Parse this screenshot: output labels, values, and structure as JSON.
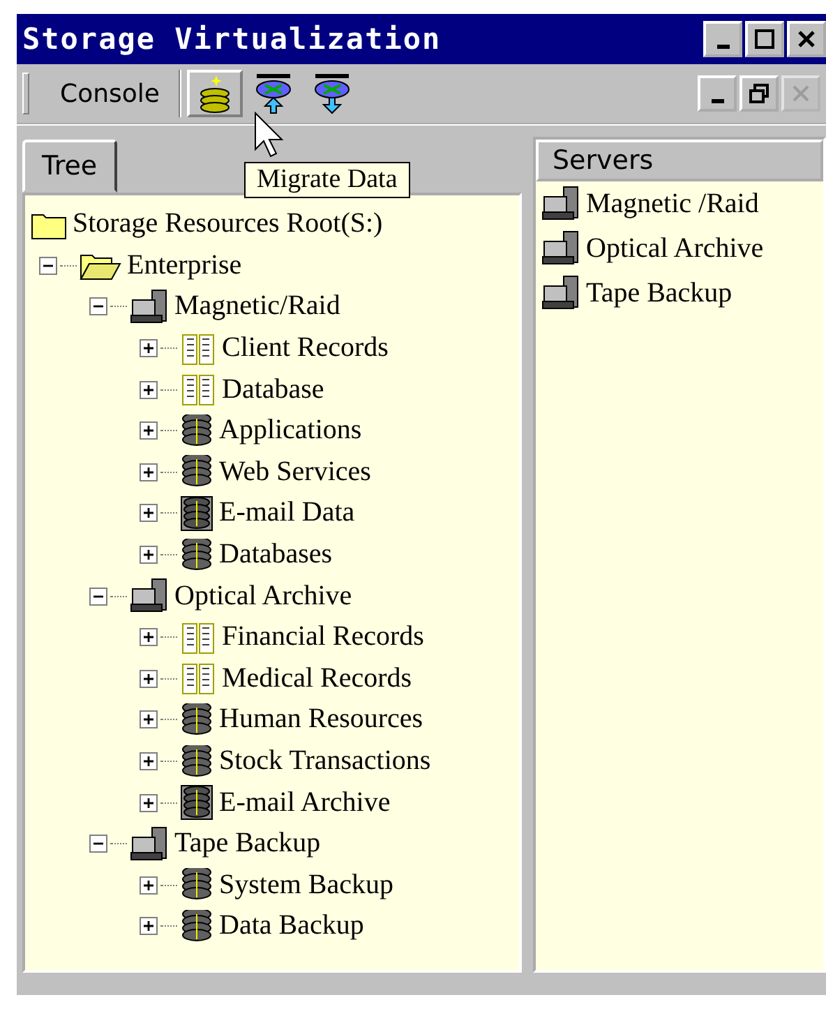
{
  "window": {
    "title": "Storage Virtualization"
  },
  "toolbar": {
    "menu": "Console",
    "buttons": [
      {
        "kind": "migrate",
        "pressed": true
      },
      {
        "kind": "upload",
        "pressed": false
      },
      {
        "kind": "download",
        "pressed": false
      }
    ],
    "tooltip": "Migrate Data"
  },
  "tabs": [
    {
      "label": "Tree",
      "selected": true
    }
  ],
  "tree": [
    {
      "label": "Storage Resources Root(S:)",
      "kind": "folder",
      "children": [
        {
          "label": "Enterprise",
          "kind": "open-folder",
          "expanded": true,
          "children": [
            {
              "label": "Magnetic/Raid",
              "kind": "server",
              "expanded": true,
              "children": [
                {
                  "label": "Client Records",
                  "kind": "book",
                  "expanded": false
                },
                {
                  "label": "Database",
                  "kind": "book",
                  "expanded": false
                },
                {
                  "label": "Applications",
                  "kind": "disk",
                  "expanded": false
                },
                {
                  "label": "Web Services",
                  "kind": "disk",
                  "expanded": false
                },
                {
                  "label": "E-mail Data",
                  "kind": "disk-box",
                  "expanded": false
                },
                {
                  "label": "Databases",
                  "kind": "disk",
                  "expanded": false
                }
              ]
            },
            {
              "label": "Optical Archive",
              "kind": "server",
              "expanded": true,
              "children": [
                {
                  "label": "Financial Records",
                  "kind": "book",
                  "expanded": false
                },
                {
                  "label": "Medical Records",
                  "kind": "book",
                  "expanded": false
                },
                {
                  "label": "Human Resources",
                  "kind": "disk",
                  "expanded": false
                },
                {
                  "label": "Stock Transactions",
                  "kind": "disk",
                  "expanded": false
                },
                {
                  "label": "E-mail Archive",
                  "kind": "disk-box",
                  "expanded": false
                }
              ]
            },
            {
              "label": "Tape Backup",
              "kind": "server",
              "expanded": true,
              "children": [
                {
                  "label": "System Backup",
                  "kind": "disk",
                  "expanded": false
                },
                {
                  "label": "Data Backup",
                  "kind": "disk",
                  "expanded": false
                }
              ]
            }
          ]
        }
      ]
    }
  ],
  "servers": {
    "header": "Servers",
    "items": [
      {
        "label": "Magnetic /Raid"
      },
      {
        "label": "Optical Archive"
      },
      {
        "label": "Tape Backup"
      }
    ]
  }
}
